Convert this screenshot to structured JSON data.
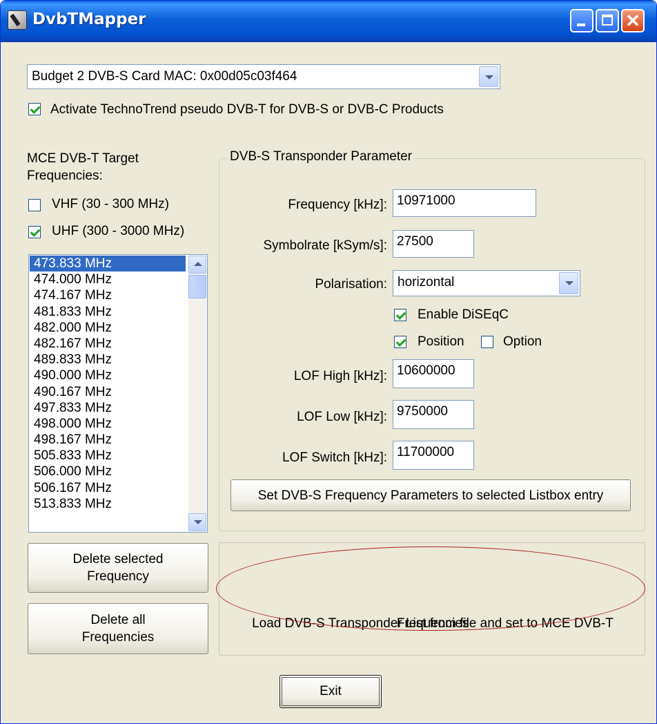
{
  "window": {
    "title": "DvbTMapper"
  },
  "device_select": {
    "value": "Budget 2 DVB-S Card MAC: 0x00d05c03f464"
  },
  "activate_checkbox": {
    "label": "Activate TechnoTrend pseudo DVB-T for DVB-S or DVB-C Products",
    "checked": true
  },
  "targets": {
    "label_line1": "MCE DVB-T Target",
    "label_line2": "Frequencies:",
    "vhf": {
      "label": "VHF (30 - 300 MHz)",
      "checked": false
    },
    "uhf": {
      "label": "UHF (300 - 3000 MHz)",
      "checked": true
    }
  },
  "frequency_list": {
    "items": [
      "473.833 MHz",
      "474.000 MHz",
      "474.167 MHz",
      "481.833 MHz",
      "482.000 MHz",
      "482.167 MHz",
      "489.833 MHz",
      "490.000 MHz",
      "490.167 MHz",
      "497.833 MHz",
      "498.000 MHz",
      "498.167 MHz",
      "505.833 MHz",
      "506.000 MHz",
      "506.167 MHz",
      "513.833 MHz"
    ],
    "selected_index": 0
  },
  "transponder": {
    "caption": "DVB-S Transponder Parameter",
    "frequency": {
      "label": "Frequency [kHz]:",
      "value": "10971000"
    },
    "symbolrate": {
      "label": "Symbolrate [kSym/s]:",
      "value": "27500"
    },
    "polarisation": {
      "label": "Polarisation:",
      "value": "horizontal"
    },
    "diseqc": {
      "label": "Enable DiSEqC",
      "checked": true
    },
    "position": {
      "label": "Position",
      "checked": true
    },
    "option": {
      "label": "Option",
      "checked": false
    },
    "lof_high": {
      "label": "LOF High [kHz]:",
      "value": "10600000"
    },
    "lof_low": {
      "label": "LOF Low [kHz]:",
      "value": "9750000"
    },
    "lof_switch": {
      "label": "LOF Switch [kHz]:",
      "value": "11700000"
    },
    "set_button": "Set DVB-S Frequency Parameters to selected Listbox entry"
  },
  "buttons": {
    "delete_selected_line1": "Delete selected",
    "delete_selected_line2": "Frequency",
    "delete_all_line1": "Delete all",
    "delete_all_line2": "Frequencies",
    "load_line1": "Load DVB-S Transponder List from file and set to MCE DVB-T",
    "load_line2": "Frequencies",
    "exit": "Exit"
  },
  "colors": {
    "titlebar": "#0a5fd8",
    "selection": "#316ac5",
    "highlight_ellipse": "#b02020",
    "dialog_background": "#ece9d8"
  },
  "icons": [
    "app-icon",
    "minimize-icon",
    "maximize-icon",
    "close-icon",
    "chevron-down-icon",
    "scroll-up-icon",
    "scroll-down-icon"
  ]
}
